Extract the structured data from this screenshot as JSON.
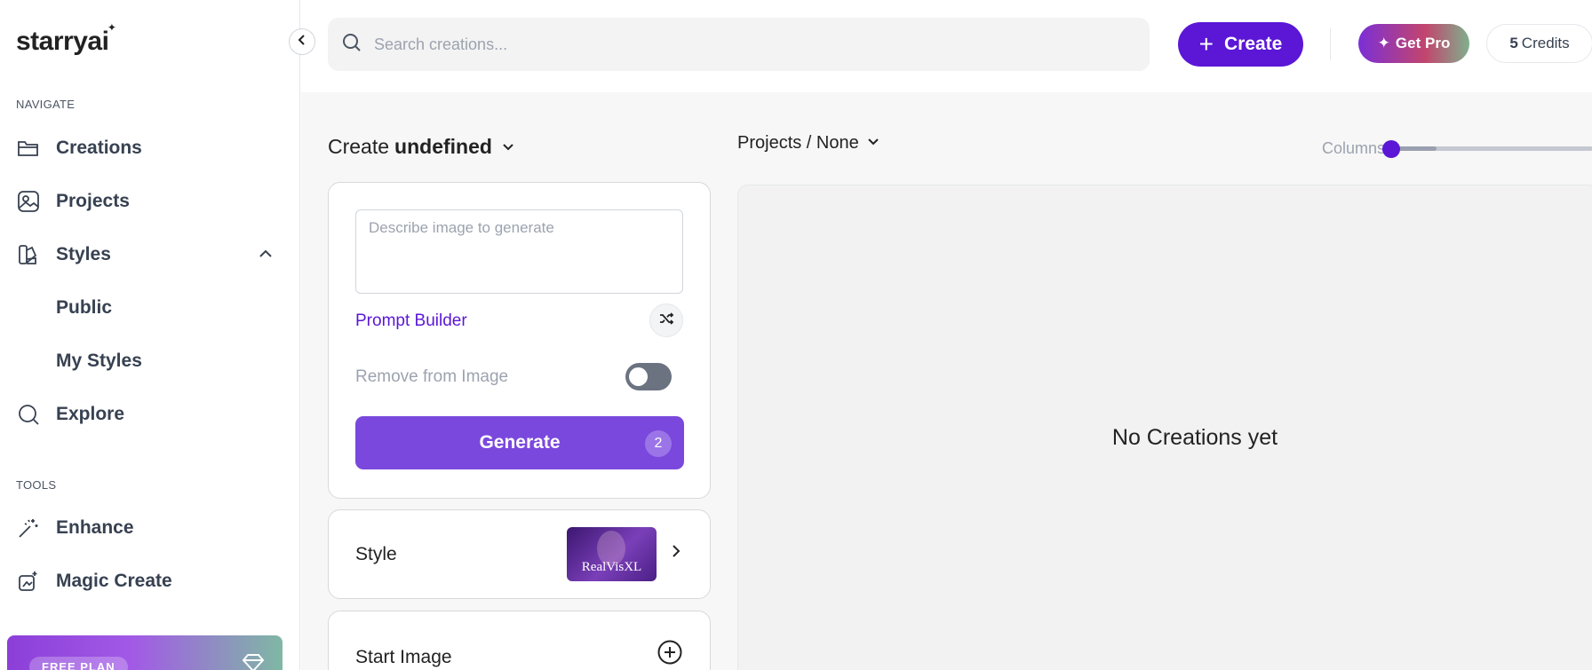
{
  "brand": {
    "name": "starryai"
  },
  "sidebar": {
    "navigate_label": "NAVIGATE",
    "tools_label": "TOOLS",
    "items": [
      {
        "label": "Creations",
        "icon": "folder-icon"
      },
      {
        "label": "Projects",
        "icon": "image-icon"
      },
      {
        "label": "Styles",
        "icon": "palette-icon"
      },
      {
        "label": "Public"
      },
      {
        "label": "My Styles"
      },
      {
        "label": "Explore",
        "icon": "search-icon"
      }
    ],
    "tools": [
      {
        "label": "Enhance",
        "icon": "magic-wand-icon"
      },
      {
        "label": "Magic Create",
        "icon": "magic-create-icon"
      }
    ],
    "plan": {
      "label": "FREE PLAN"
    }
  },
  "topbar": {
    "search_placeholder": "Search creations...",
    "create_label": "Create",
    "pro_label": "Get Pro",
    "credits_count": "5",
    "credits_label": "Credits"
  },
  "main": {
    "create_prefix": "Create",
    "create_mode": "undefined",
    "prompt_placeholder": "Describe image to generate",
    "prompt_builder": "Prompt Builder",
    "remove_from_image": "Remove from Image",
    "remove_toggle_on": false,
    "generate_label": "Generate",
    "generate_cost": "2",
    "style_label": "Style",
    "style_selected": "RealVisXL",
    "start_image_label": "Start Image",
    "projects_label": "Projects / None",
    "columns_label": "Columns",
    "columns_level": 0.2,
    "empty_message": "No Creations yet"
  },
  "colors": {
    "accent": "#5b16d6",
    "generate": "#7a48dd",
    "toggle_off": "#6b7280"
  }
}
